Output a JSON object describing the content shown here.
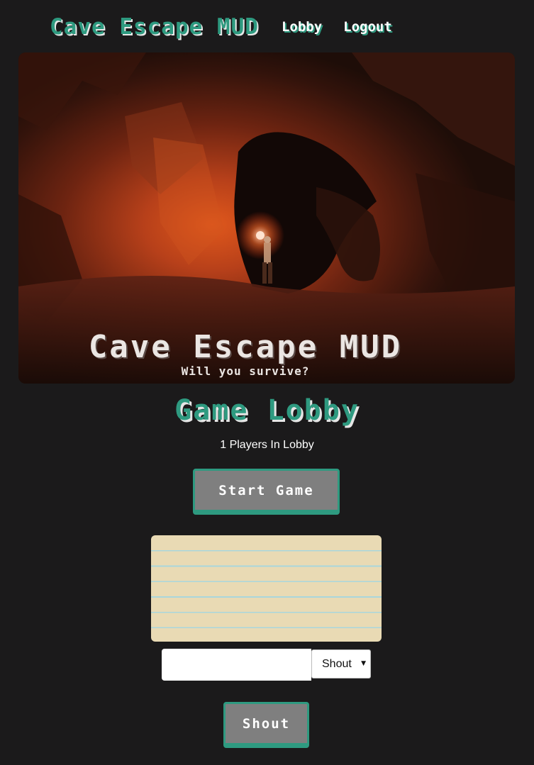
{
  "nav": {
    "brand": "Cave Escape MUD",
    "lobby_link": "Lobby",
    "logout_link": "Logout"
  },
  "banner": {
    "title": "Cave Escape MUD",
    "subtitle": "Will you survive?"
  },
  "lobby": {
    "title": "Game Lobby",
    "players_text": "1 Players In Lobby",
    "start_button": "Start Game"
  },
  "chat": {
    "input_value": "",
    "mode_selected": "Shout",
    "send_button": "Shout"
  },
  "colors": {
    "background": "#1b1a1b",
    "accent": "#2e9a80",
    "button_gray": "#7f7f7f",
    "paper": "#e9dab4",
    "paper_lines": "#a9d6dc"
  }
}
